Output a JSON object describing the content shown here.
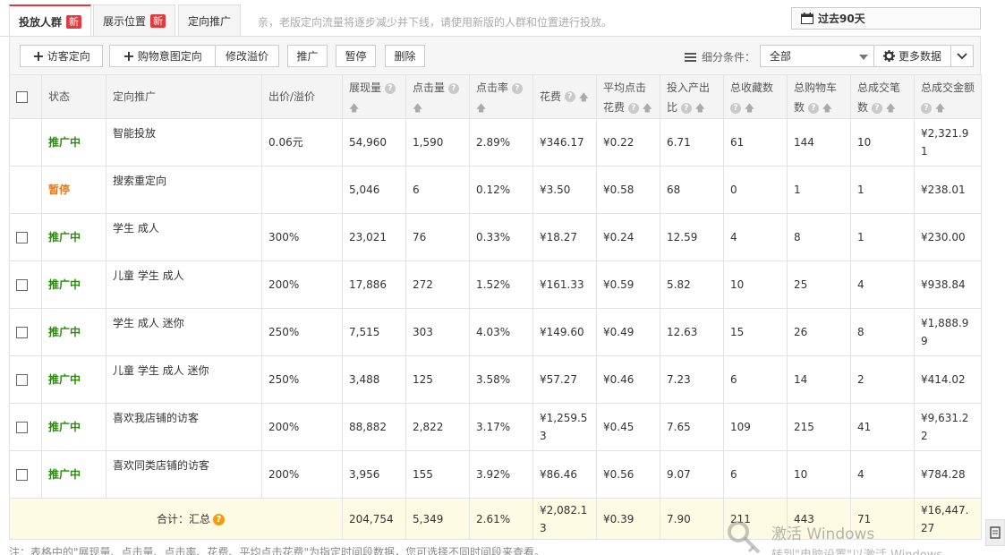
{
  "tabs": [
    {
      "label": "投放人群",
      "badge": "新"
    },
    {
      "label": "展示位置",
      "badge": "新"
    },
    {
      "label": "定向推广",
      "badge": ""
    }
  ],
  "notice": "亲，老版定向流量将逐步减少并下线，请使用新版的人群和位置进行投放。",
  "period": "过去90天",
  "toolbar": {
    "visitor_btn": "访客定向",
    "cart_btn": "购物意图定向",
    "bid_btn": "修改溢价",
    "promote_btn": "推广",
    "pause_btn": "暂停",
    "delete_btn": "删除",
    "filter_label": "细分条件：",
    "filter_value": "全部",
    "more_btn": "更多数据"
  },
  "columns": {
    "status": "状态",
    "target": "定向推广",
    "bid": "出价/溢价",
    "impressions": "展现量",
    "clicks": "点击量",
    "ctr": "点击率",
    "cost": "花费",
    "cpc": "平均点击花费",
    "roi": "投入产出比",
    "favorites": "总收藏数",
    "carts": "总购物车数",
    "orders": "总成交笔数",
    "gmv": "总成交金额"
  },
  "rows": [
    {
      "status": "推广中",
      "name": "智能投放",
      "bid": "0.06元",
      "impressions": "54,960",
      "clicks": "1,590",
      "ctr": "2.89%",
      "cost": "¥346.17",
      "cpc": "¥0.22",
      "roi": "6.71",
      "favorites": "61",
      "carts": "144",
      "orders": "10",
      "gmv": "¥2,321.91"
    },
    {
      "status": "暂停",
      "name": "搜索重定向",
      "bid": "",
      "impressions": "5,046",
      "clicks": "6",
      "ctr": "0.12%",
      "cost": "¥3.50",
      "cpc": "¥0.58",
      "roi": "68",
      "favorites": "0",
      "carts": "1",
      "orders": "1",
      "gmv": "¥238.01"
    },
    {
      "status": "推广中",
      "name": "学生 成人",
      "bid": "300%",
      "impressions": "23,021",
      "clicks": "76",
      "ctr": "0.33%",
      "cost": "¥18.27",
      "cpc": "¥0.24",
      "roi": "12.59",
      "favorites": "4",
      "carts": "8",
      "orders": "1",
      "gmv": "¥230.00"
    },
    {
      "status": "推广中",
      "name": "儿童 学生 成人",
      "bid": "200%",
      "impressions": "17,886",
      "clicks": "272",
      "ctr": "1.52%",
      "cost": "¥161.33",
      "cpc": "¥0.59",
      "roi": "5.82",
      "favorites": "10",
      "carts": "25",
      "orders": "4",
      "gmv": "¥938.84"
    },
    {
      "status": "推广中",
      "name": "学生 成人 迷你",
      "bid": "250%",
      "impressions": "7,515",
      "clicks": "303",
      "ctr": "4.03%",
      "cost": "¥149.60",
      "cpc": "¥0.49",
      "roi": "12.63",
      "favorites": "15",
      "carts": "26",
      "orders": "8",
      "gmv": "¥1,888.99"
    },
    {
      "status": "推广中",
      "name": "儿童 学生 成人 迷你",
      "bid": "250%",
      "impressions": "3,488",
      "clicks": "125",
      "ctr": "3.58%",
      "cost": "¥57.27",
      "cpc": "¥0.46",
      "roi": "7.23",
      "favorites": "6",
      "carts": "14",
      "orders": "2",
      "gmv": "¥414.02"
    },
    {
      "status": "推广中",
      "name": "喜欢我店铺的访客",
      "bid": "200%",
      "impressions": "88,882",
      "clicks": "2,822",
      "ctr": "3.17%",
      "cost": "¥1,259.53",
      "cpc": "¥0.45",
      "roi": "7.65",
      "favorites": "109",
      "carts": "215",
      "orders": "41",
      "gmv": "¥9,631.22"
    },
    {
      "status": "推广中",
      "name": "喜欢同类店铺的访客",
      "bid": "200%",
      "impressions": "3,956",
      "clicks": "155",
      "ctr": "3.92%",
      "cost": "¥86.46",
      "cpc": "¥0.56",
      "roi": "9.07",
      "favorites": "6",
      "carts": "10",
      "orders": "4",
      "gmv": "¥784.28"
    }
  ],
  "total": {
    "label": "合计：汇总",
    "impressions": "204,754",
    "clicks": "5,349",
    "ctr": "2.61%",
    "cost": "¥2,082.13",
    "cpc": "¥0.39",
    "roi": "7.90",
    "favorites": "211",
    "carts": "443",
    "orders": "71",
    "gmv": "¥16,447.27"
  },
  "footnote": "注：表格中的\"展现量、点击量、点击率、花费、平均点击花费\"为指定时间段数据，您可选择不同时间段来查看。",
  "watermark": {
    "line1": "激活 Windows",
    "line2": "转到\"电脑设置\"以激活 Windows。"
  }
}
